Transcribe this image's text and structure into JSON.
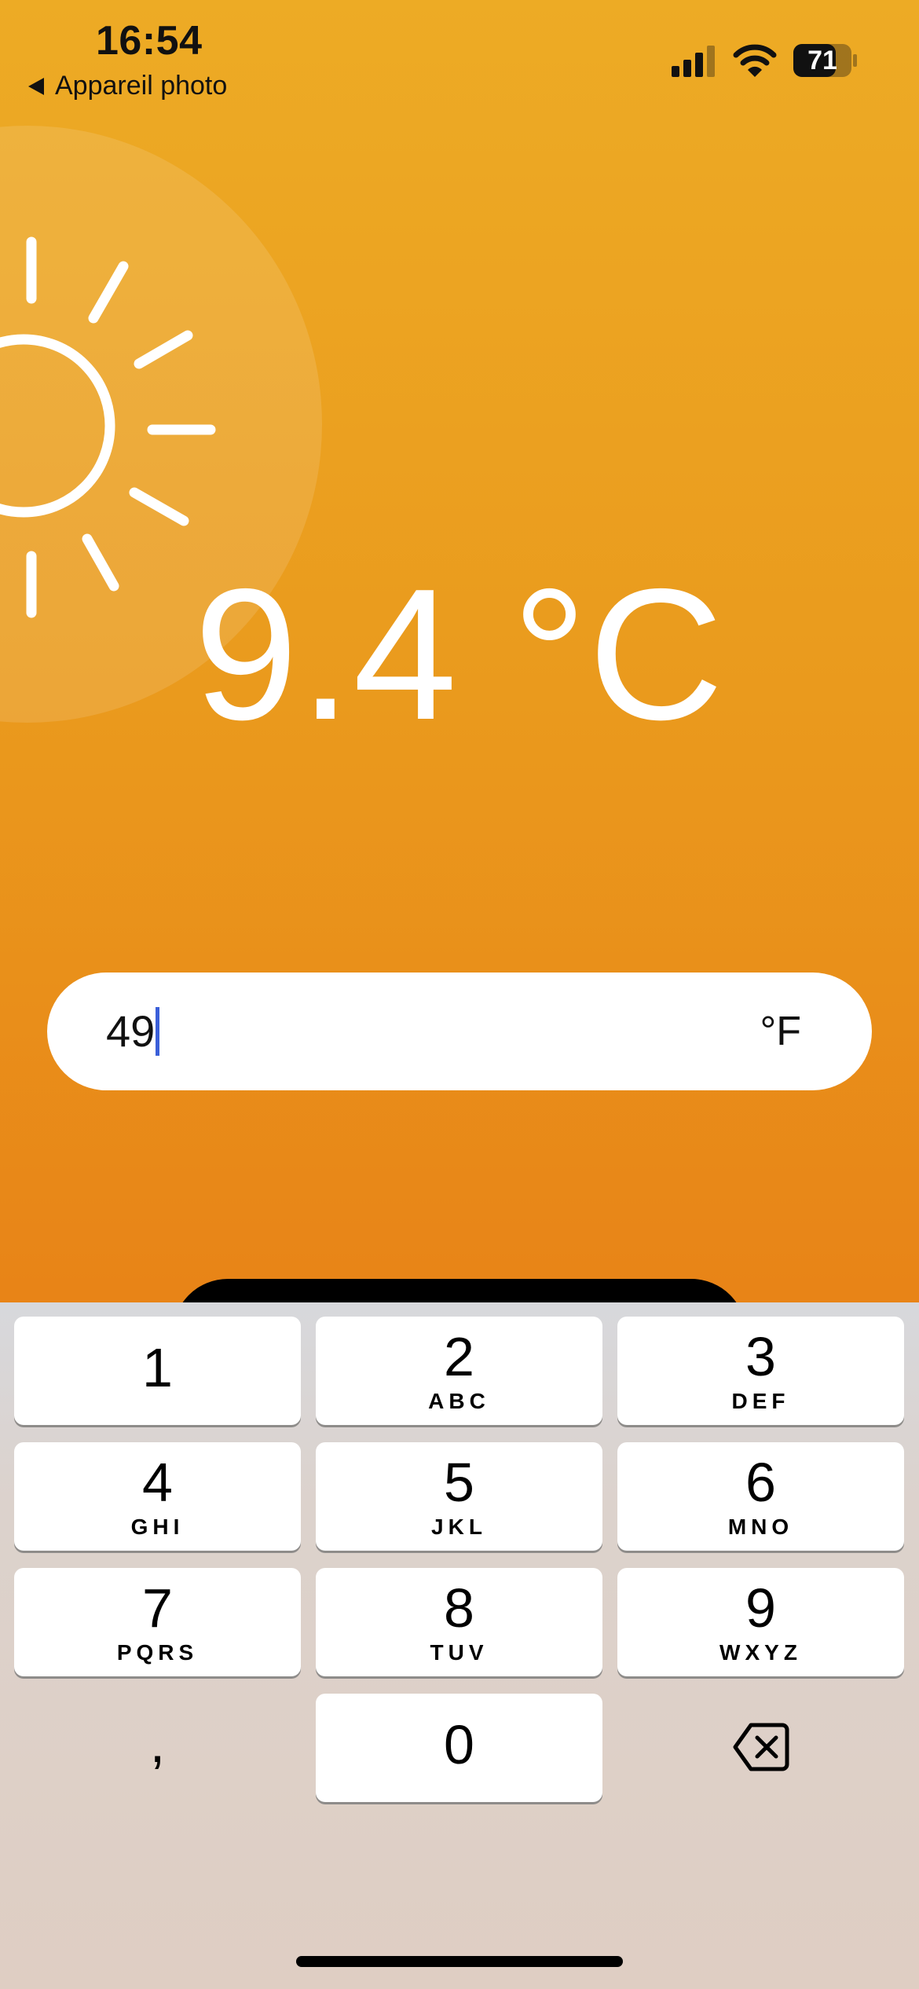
{
  "status_bar": {
    "time": "16:54",
    "back_label": "Appareil photo",
    "battery": "71",
    "icons": [
      "signal-icon",
      "wifi-icon",
      "battery-icon"
    ]
  },
  "weather": {
    "icon": "sun-icon",
    "temperature": "9.4 °C"
  },
  "input": {
    "value": "49",
    "unit": "°F"
  },
  "keyboard": {
    "keys": [
      {
        "digit": "1",
        "letters": ""
      },
      {
        "digit": "2",
        "letters": "ABC"
      },
      {
        "digit": "3",
        "letters": "DEF"
      },
      {
        "digit": "4",
        "letters": "GHI"
      },
      {
        "digit": "5",
        "letters": "JKL"
      },
      {
        "digit": "6",
        "letters": "MNO"
      },
      {
        "digit": "7",
        "letters": "PQRS"
      },
      {
        "digit": "8",
        "letters": "TUV"
      },
      {
        "digit": "9",
        "letters": "WXYZ"
      }
    ],
    "decimal": ",",
    "zero": "0",
    "delete_icon": "delete-backspace-icon"
  },
  "colors": {
    "background_top": "#EDAB25",
    "background_bottom": "#E67914",
    "caret": "#3A5FD9"
  }
}
